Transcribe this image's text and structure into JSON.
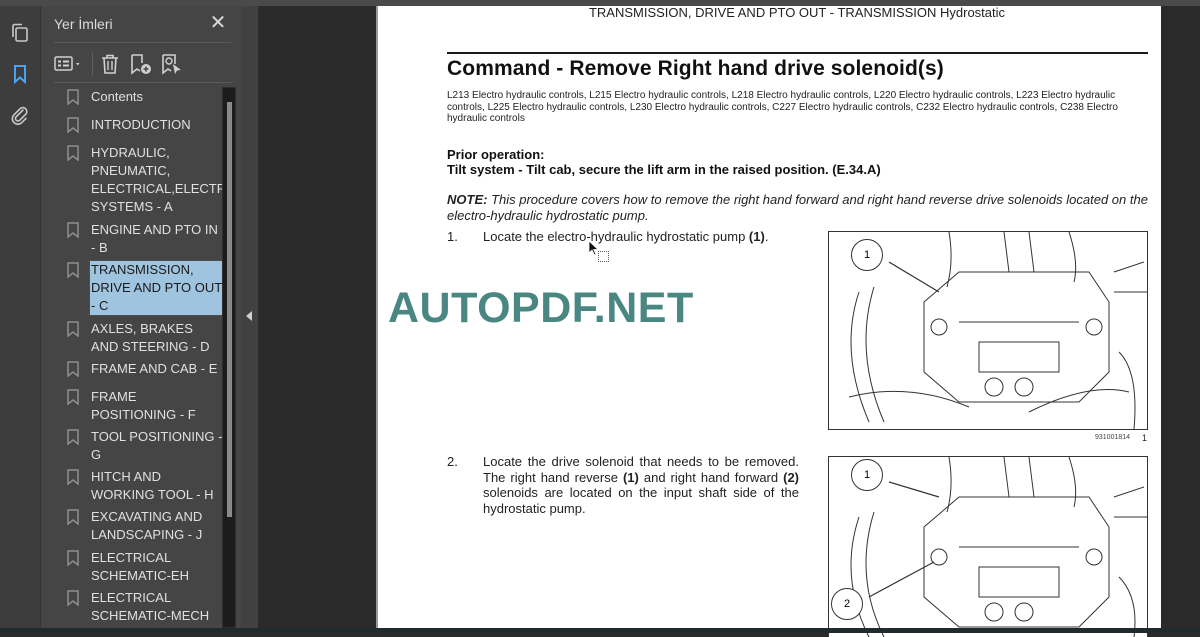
{
  "sidebar_rail": {
    "icons": [
      {
        "name": "page-thumbnails-icon"
      },
      {
        "name": "bookmarks-icon",
        "active": true
      },
      {
        "name": "attachments-icon"
      }
    ],
    "active_color": "#4aa3f0"
  },
  "bookmarks_panel": {
    "title": "Yer İmleri",
    "close_label": "✕",
    "toolbar": [
      {
        "name": "options-menu-icon"
      },
      {
        "name": "delete-bookmark-icon"
      },
      {
        "name": "add-bookmark-icon"
      },
      {
        "name": "find-current-bookmark-icon"
      }
    ],
    "items": [
      {
        "label": "Contents"
      },
      {
        "label": "INTRODUCTION"
      },
      {
        "label": "HYDRAULIC, PNEUMATIC, ELECTRICAL,ELECTRONIC SYSTEMS - A"
      },
      {
        "label": "ENGINE AND PTO IN - B"
      },
      {
        "label": "TRANSMISSION, DRIVE AND PTO OUT - C",
        "selected": true
      },
      {
        "label": "AXLES, BRAKES AND STEERING - D"
      },
      {
        "label": "FRAME AND CAB - E"
      },
      {
        "label": "FRAME POSITIONING - F"
      },
      {
        "label": "TOOL POSITIONING - G"
      },
      {
        "label": "HITCH AND WORKING TOOL - H"
      },
      {
        "label": "EXCAVATING AND LANDSCAPING - J"
      },
      {
        "label": "ELECTRICAL SCHEMATIC-EH"
      },
      {
        "label": "ELECTRICAL SCHEMATIC-MECH"
      }
    ],
    "selected_color": "#9fc4e0"
  },
  "document": {
    "running_head": "TRANSMISSION, DRIVE AND PTO OUT - TRANSMISSION Hydrostatic",
    "title": "Command - Remove Right hand drive solenoid(s)",
    "models": "L213 Electro hydraulic controls, L215 Electro hydraulic controls, L218 Electro hydraulic controls, L220 Electro hydraulic controls, L223 Electro hydraulic controls, L225 Electro hydraulic controls, L230 Electro hydraulic controls, C227 Electro hydraulic controls, C232 Electro hydraulic controls, C238 Electro hydraulic controls",
    "prior_operation_label": "Prior operation:",
    "prior_operation": "Tilt system - Tilt cab, secure the lift arm in the raised position.",
    "prior_operation_ref": "(E.34.A)",
    "note_label": "NOTE:",
    "note_text": "This procedure covers how to remove the right hand forward and right hand reverse drive solenoids located on the electro-hydraulic hydrostatic pump.",
    "steps": [
      {
        "num": "1.",
        "text_a": "Locate the electro-hydraulic hydrostatic pump ",
        "ref_1": "(1)",
        "text_b": "."
      },
      {
        "num": "2.",
        "text_a": "Locate the drive solenoid that needs to be removed. The right hand reverse ",
        "ref_1": "(1)",
        "text_b": " and right hand forward ",
        "ref_2": "(2)",
        "text_c": " solenoids are located on the input shaft side of the hydrostatic pump."
      }
    ],
    "figures": [
      {
        "callouts": [
          "1"
        ],
        "caption_code": "931001814",
        "figure_number": "1"
      },
      {
        "callouts": [
          "1",
          "2"
        ]
      }
    ],
    "watermark": "AUTOPDF.NET",
    "watermark_color": "#4a8782"
  }
}
